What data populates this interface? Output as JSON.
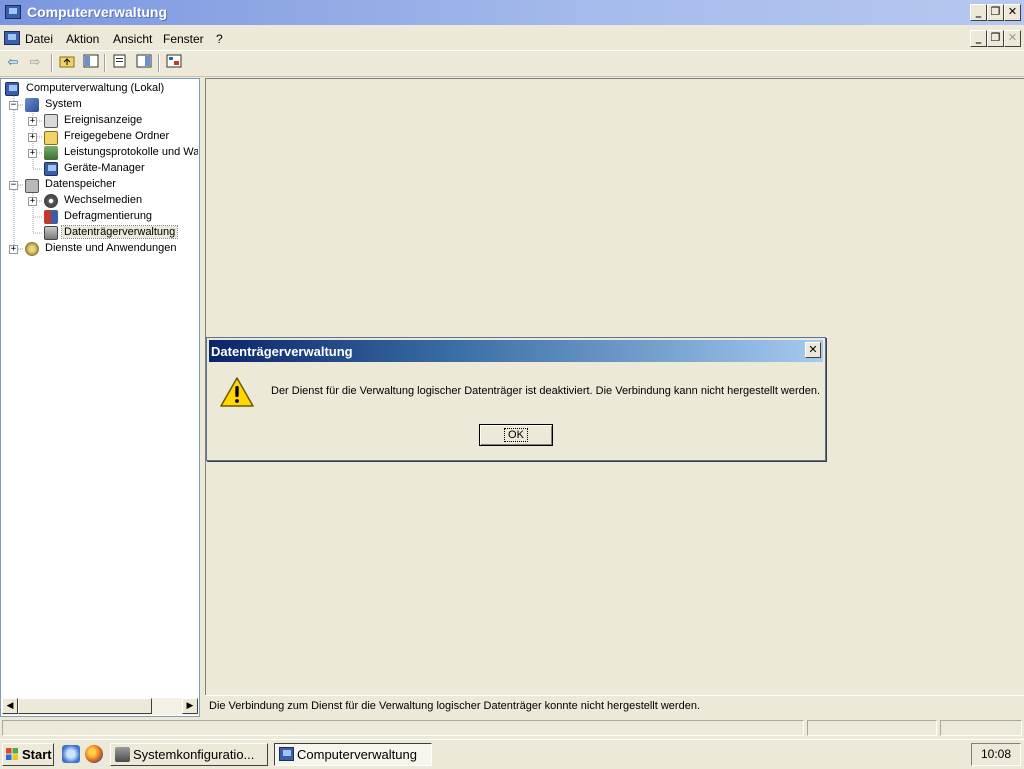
{
  "window": {
    "title": "Computerverwaltung",
    "minimize_glyph": "_",
    "restore_glyph": "❐",
    "close_glyph": "✕"
  },
  "menu": {
    "items": [
      "Datei",
      "Aktion",
      "Ansicht",
      "Fenster",
      "?"
    ]
  },
  "toolbar": {
    "icons": [
      "back-arrow-icon",
      "forward-arrow-icon",
      "up-folder-icon",
      "show-hide-tree-icon",
      "properties-icon",
      "help-icon",
      "export-list-icon"
    ]
  },
  "tree": {
    "items": [
      {
        "label": "Computerverwaltung (Lokal)",
        "icon": "computer-icon"
      },
      {
        "label": "System",
        "icon": "system-tools-icon"
      },
      {
        "label": "Ereignisanzeige",
        "icon": "event-viewer-icon"
      },
      {
        "label": "Freigegebene Ordner",
        "icon": "shared-folder-icon"
      },
      {
        "label": "Leistungsprotokolle und War",
        "icon": "performance-logs-icon"
      },
      {
        "label": "Geräte-Manager",
        "icon": "device-manager-icon"
      },
      {
        "label": "Datenspeicher",
        "icon": "storage-icon"
      },
      {
        "label": "Wechselmedien",
        "icon": "removable-media-icon"
      },
      {
        "label": "Defragmentierung",
        "icon": "defrag-icon"
      },
      {
        "label": "Datenträgerverwaltung",
        "icon": "disk-management-icon"
      },
      {
        "label": "Dienste und Anwendungen",
        "icon": "services-apps-icon"
      }
    ]
  },
  "right_pane": {
    "status_message": "Die Verbindung zum Dienst für die Verwaltung logischer Datenträger konnte nicht hergestellt werden."
  },
  "dialog": {
    "title": "Datenträgerverwaltung",
    "message": "Der Dienst für die Verwaltung logischer Datenträger ist deaktiviert. Die Verbindung kann nicht hergestellt werden.",
    "ok_label": "OK",
    "icon": "warning-icon"
  },
  "taskbar": {
    "start_label": "Start",
    "tasks": [
      {
        "label": "Systemkonfiguratio...",
        "active": false
      },
      {
        "label": "Computerverwaltung",
        "active": true
      }
    ],
    "clock": "10:08"
  }
}
